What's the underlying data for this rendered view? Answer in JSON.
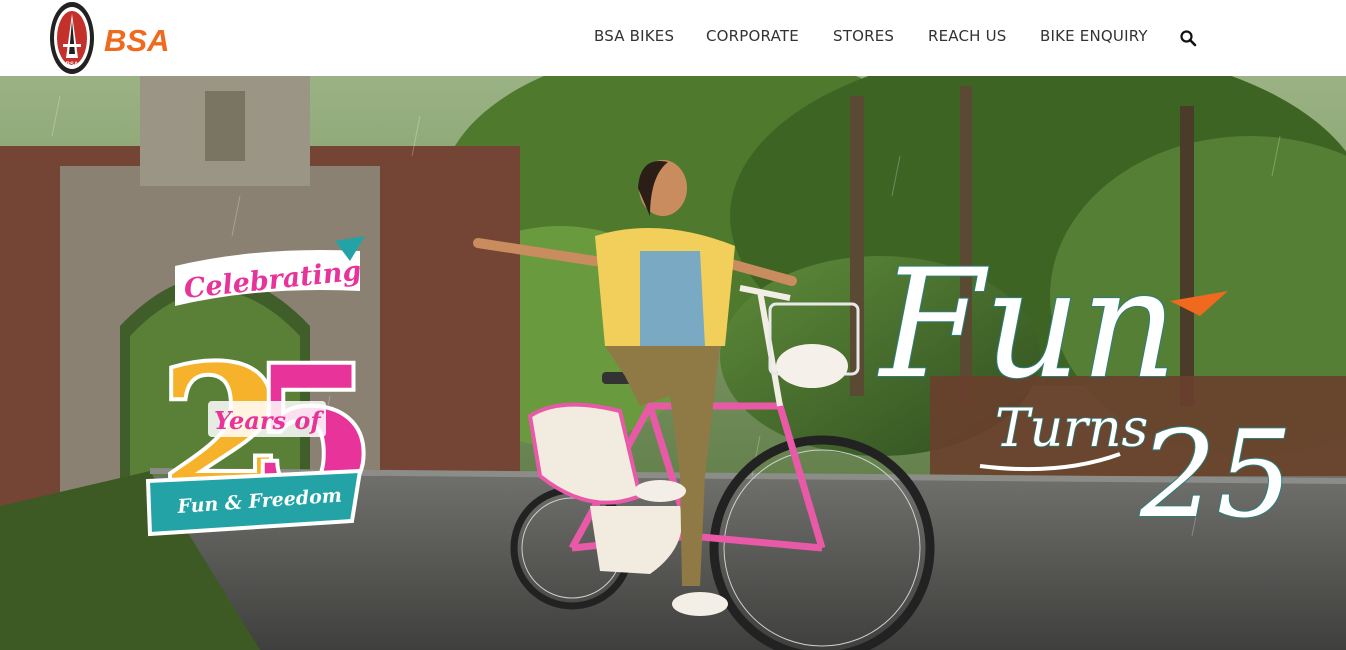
{
  "brand": {
    "name": "BSA",
    "logo_color": "#ef6a1e"
  },
  "nav": {
    "items": [
      "BSA BIKES",
      "CORPORATE",
      "STORES",
      "REACH US",
      "BIKE ENQUIRY"
    ],
    "search_icon": "search-icon"
  },
  "hero": {
    "badge": {
      "line1": "Celebrating",
      "number": "25",
      "line2": "Years of",
      "ribbon": "Fun & Freedom"
    },
    "tagline": {
      "word1": "Fun",
      "word2": "Turns",
      "number": "25"
    },
    "colors": {
      "pink": "#e8339a",
      "yellow": "#f5b22a",
      "teal": "#23a3a6",
      "orange": "#ef6a1e"
    }
  }
}
